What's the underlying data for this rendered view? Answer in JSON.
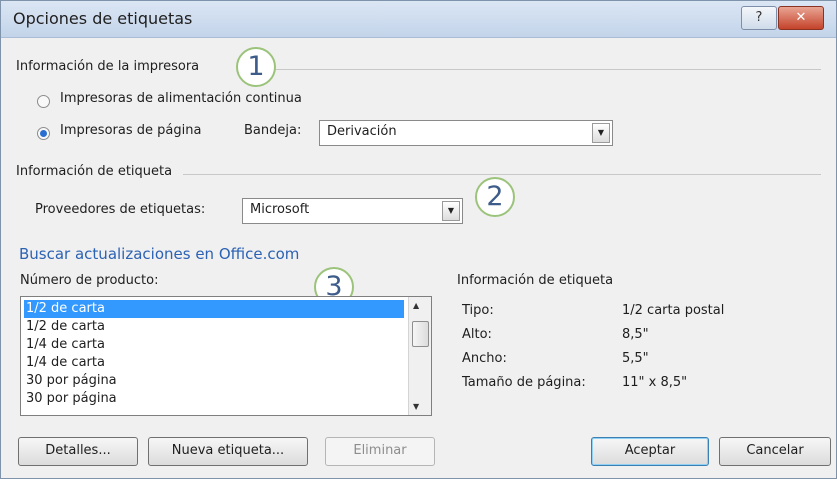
{
  "window": {
    "title": "Opciones de etiquetas",
    "help_label": "?",
    "close_label": "✕"
  },
  "printer_info": {
    "label": "Información de la impresora",
    "continuous_label": "Impresoras de alimentación continua",
    "page_label": "Impresoras de página",
    "selected": "page",
    "tray_label": "Bandeja:",
    "tray_value": "Derivación"
  },
  "label_info": {
    "label": "Información de etiqueta",
    "vendor_label": "Proveedores de etiquetas:",
    "vendor_value": "Microsoft"
  },
  "update_link": "Buscar actualizaciones en Office.com",
  "product": {
    "label": "Número de producto:",
    "items": [
      "1/2 de carta",
      "1/2 de carta",
      "1/4 de carta",
      "1/4 de carta",
      "30 por página",
      "30 por página"
    ],
    "selected_index": 0
  },
  "details": {
    "title": "Información de etiqueta",
    "rows": [
      {
        "key": "Tipo:",
        "value": "1/2 carta postal"
      },
      {
        "key": "Alto:",
        "value": "8,5\""
      },
      {
        "key": "Ancho:",
        "value": "5,5\""
      },
      {
        "key": "Tamaño de página:",
        "value": "11\" x 8,5\""
      }
    ]
  },
  "callouts": [
    "1",
    "2",
    "3"
  ],
  "buttons": {
    "details": "Detalles...",
    "new_label": "Nueva etiqueta...",
    "delete": "Eliminar",
    "ok": "Aceptar",
    "cancel": "Cancelar"
  },
  "icons": {
    "dropdown": "dropdown-arrow-icon",
    "scroll_up": "scroll-up-icon",
    "scroll_down": "scroll-down-icon"
  },
  "colors": {
    "selection": "#3399ff",
    "link": "#2b62b4",
    "callout_border": "#9cc37b",
    "callout_text": "#3d5c8a"
  }
}
